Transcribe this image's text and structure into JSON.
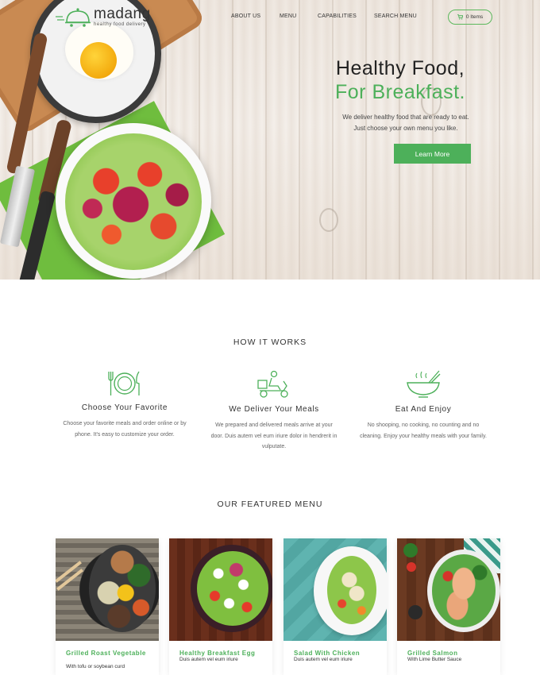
{
  "brand": {
    "name": "madang",
    "tagline": "healthy food delivery"
  },
  "nav": {
    "items": [
      {
        "label": "ABOUT US"
      },
      {
        "label": "MENU"
      },
      {
        "label": "CAPABILITIES"
      },
      {
        "label": "SEARCH MENU"
      }
    ],
    "cart_label": "0 Items"
  },
  "hero": {
    "title_line1": "Healthy Food,",
    "title_line2": "For Breakfast.",
    "description": "We deliver healthy food that are ready to eat. Just choose your own menu you like.",
    "cta_label": "Learn More"
  },
  "how_it_works": {
    "title": "HOW IT WORKS",
    "steps": [
      {
        "icon": "plate-cutlery-icon",
        "title": "Choose Your Favorite",
        "text": "Choose your favorite meals and order online or by phone. It's easy to customize your order."
      },
      {
        "icon": "delivery-scooter-icon",
        "title": "We Deliver Your Meals",
        "text": "We prepared and delivered meals arrive at your door. Duis autem vel eum iriure dolor in hendrerit in vulputate."
      },
      {
        "icon": "bowl-chopsticks-icon",
        "title": "Eat And Enjoy",
        "text": "No shooping, no cooking, no counting and no cleaning. Enjoy your healthy meals with your family."
      }
    ]
  },
  "featured_menu": {
    "title": "OUR FEATURED MENU",
    "items": [
      {
        "name": "Grilled Roast Vegetable",
        "subtitle": "With tofu or soybean curd"
      },
      {
        "name": "Healthy Breakfast Egg",
        "subtitle": "Duis autem vel eum iriure"
      },
      {
        "name": "Salad With Chicken",
        "subtitle": "Duis autem vel eum iriure"
      },
      {
        "name": "Grilled Salmon",
        "subtitle": "With Lime Butter Sauce"
      }
    ]
  },
  "colors": {
    "accent": "#4db05a",
    "text": "#333333"
  }
}
